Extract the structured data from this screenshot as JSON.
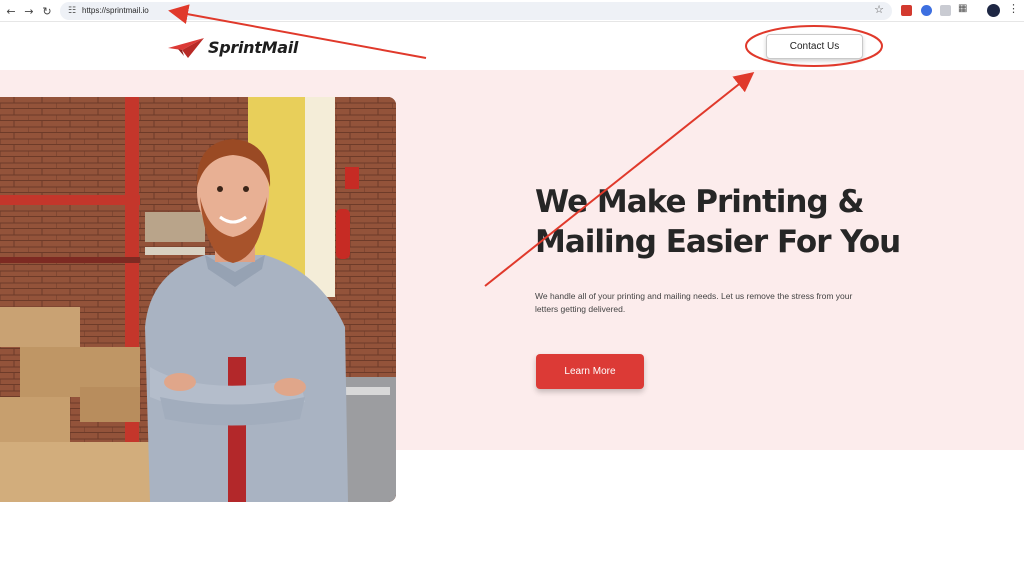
{
  "browser": {
    "url": "https://sprintmail.io",
    "icons": {
      "back": "arrow-left-icon",
      "forward": "arrow-right-icon",
      "reload": "reload-icon",
      "site_info": "tune-icon",
      "bookmark": "star-icon",
      "extensions": "puzzle-icon",
      "menu": "kebab-menu-icon"
    }
  },
  "site": {
    "brand": "SprintMail",
    "brand_color": "#dc3a36",
    "nav": {
      "contact_label": "Contact Us"
    }
  },
  "hero": {
    "title_line1": "We Make Printing &",
    "title_line2": "Mailing Easier For You",
    "description": "We handle all of your printing and mailing needs. Let us remove the stress from your letters getting delivered.",
    "cta_label": "Learn More",
    "background_color": "#fcecec"
  },
  "annotations": {
    "color": "#e0392b"
  }
}
